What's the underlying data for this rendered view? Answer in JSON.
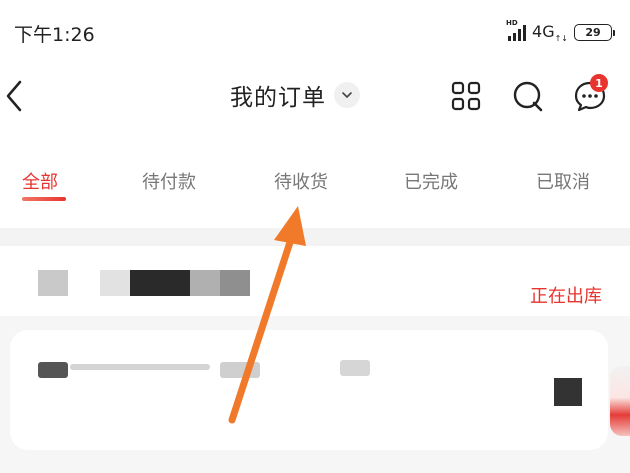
{
  "status_bar": {
    "time": "下午1:26",
    "hd_label": "HD",
    "network": "4G",
    "network_sub": "↑↓",
    "battery": "29"
  },
  "nav": {
    "title": "我的订单",
    "icons": [
      "back-icon",
      "chevron-down-icon",
      "grid-icon",
      "search-icon",
      "message-icon"
    ],
    "message_badge": "1"
  },
  "tabs": [
    {
      "label": "全部",
      "active": true
    },
    {
      "label": "待付款",
      "active": false
    },
    {
      "label": "待收货",
      "active": false
    },
    {
      "label": "已完成",
      "active": false
    },
    {
      "label": "已取消",
      "active": false
    }
  ],
  "order": {
    "status": "正在出库"
  },
  "colors": {
    "accent": "#e8342e",
    "annotation_arrow": "#f07a2a",
    "tab_inactive": "#777777",
    "band": "#f3f3f3"
  }
}
